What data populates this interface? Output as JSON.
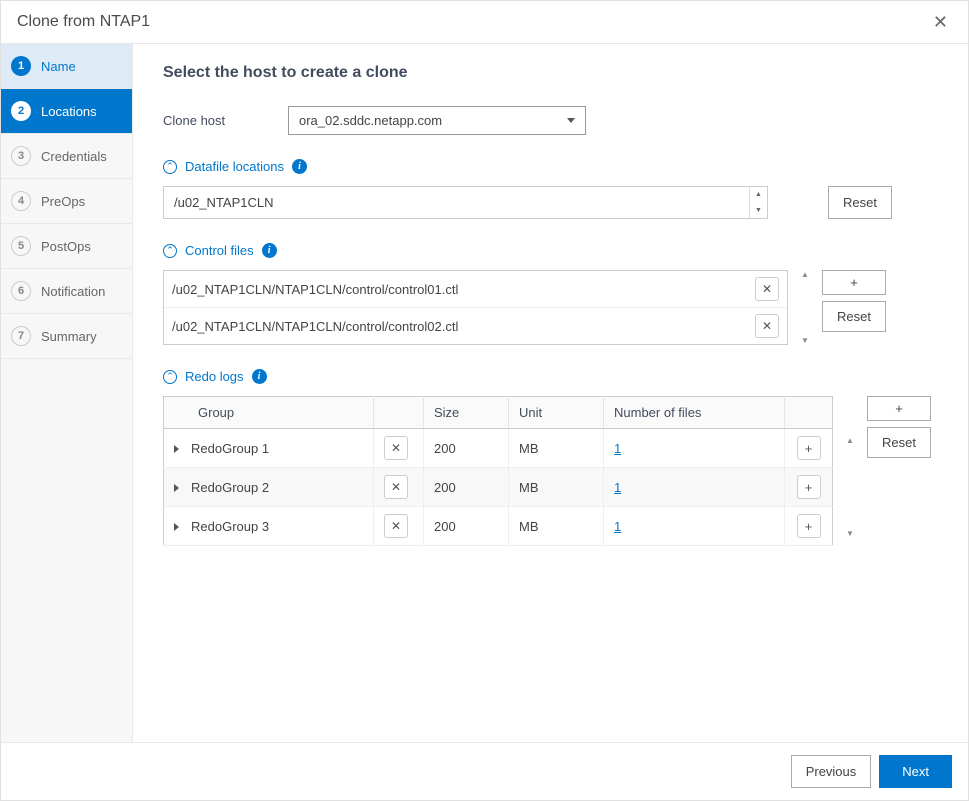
{
  "modal": {
    "title": "Clone from NTAP1"
  },
  "sidebar": {
    "items": [
      {
        "num": "1",
        "label": "Name"
      },
      {
        "num": "2",
        "label": "Locations"
      },
      {
        "num": "3",
        "label": "Credentials"
      },
      {
        "num": "4",
        "label": "PreOps"
      },
      {
        "num": "5",
        "label": "PostOps"
      },
      {
        "num": "6",
        "label": "Notification"
      },
      {
        "num": "7",
        "label": "Summary"
      }
    ]
  },
  "content": {
    "heading": "Select the host to create a clone",
    "clone_host_label": "Clone host",
    "clone_host_value": "ora_02.sddc.netapp.com",
    "datafile_section": "Datafile locations",
    "datafile_location": "/u02_NTAP1CLN",
    "controlfiles_section": "Control files",
    "control_files": [
      "/u02_NTAP1CLN/NTAP1CLN/control/control01.ctl",
      "/u02_NTAP1CLN/NTAP1CLN/control/control02.ctl"
    ],
    "redo_section": "Redo logs",
    "redo_headers": {
      "group": "Group",
      "size": "Size",
      "unit": "Unit",
      "nof": "Number of files"
    },
    "redo_groups": [
      {
        "name": "RedoGroup 1",
        "size": "200",
        "unit": "MB",
        "files": "1"
      },
      {
        "name": "RedoGroup 2",
        "size": "200",
        "unit": "MB",
        "files": "1"
      },
      {
        "name": "RedoGroup 3",
        "size": "200",
        "unit": "MB",
        "files": "1"
      }
    ]
  },
  "buttons": {
    "reset": "Reset",
    "plus": "+",
    "previous": "Previous",
    "next": "Next"
  }
}
